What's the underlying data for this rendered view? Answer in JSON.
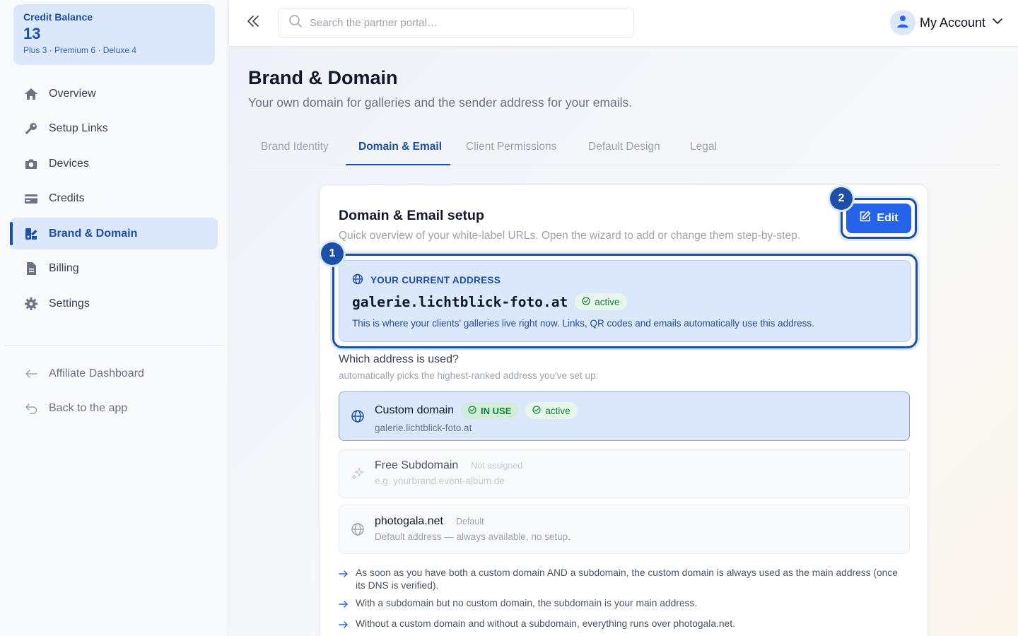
{
  "credit": {
    "title": "Credit Balance",
    "value": "13",
    "sub": "Plus 3 · Premium 6 · Deluxe 4"
  },
  "sidebar": {
    "items": [
      {
        "label": "Overview",
        "icon": "home-icon"
      },
      {
        "label": "Setup Links",
        "icon": "key-icon"
      },
      {
        "label": "Devices",
        "icon": "camera-icon"
      },
      {
        "label": "Credits",
        "icon": "credit-card-icon"
      },
      {
        "label": "Brand & Domain",
        "icon": "brand-icon",
        "active": true
      },
      {
        "label": "Billing",
        "icon": "document-icon"
      },
      {
        "label": "Settings",
        "icon": "gear-icon"
      }
    ],
    "bottom": [
      {
        "label": "Affiliate Dashboard",
        "icon": "arrow-left-icon"
      },
      {
        "label": "Back to the app",
        "icon": "undo-icon"
      }
    ]
  },
  "topbar": {
    "search_placeholder": "Search the partner portal…",
    "account_label": "My Account"
  },
  "page": {
    "title": "Brand & Domain",
    "subtitle": "Your own domain for galleries and the sender address for your emails."
  },
  "tabs": [
    {
      "label": "Brand Identity"
    },
    {
      "label": "Domain & Email",
      "active": true
    },
    {
      "label": "Client Permissions"
    },
    {
      "label": "Default Design"
    },
    {
      "label": "Legal"
    }
  ],
  "card": {
    "title": "Domain & Email setup",
    "subtitle": "Quick overview of your white-label URLs. Open the wizard to add or change them step-by-step.",
    "edit_label": "Edit",
    "step1": "1",
    "step2": "2",
    "current": {
      "label": "YOUR CURRENT ADDRESS",
      "domain": "galerie.lichtblick-foto.at",
      "status": "active",
      "note": "This is where your clients' galleries live right now. Links, QR codes and emails automatically use this address."
    },
    "which": {
      "title": "Which address is used?",
      "subtitle": "automatically picks the highest-ranked address you've set up:"
    },
    "options": [
      {
        "name": "Custom domain",
        "badge": "IN USE",
        "status": "active",
        "desc": "galerie.lichtblick-foto.at"
      },
      {
        "name": "Free Subdomain",
        "tag": "Not assigned",
        "desc": "e.g. yourbrand.event-album.de"
      },
      {
        "name": "photogala.net",
        "tag": "Default",
        "desc": "Default address — always available, no setup."
      }
    ],
    "rules": [
      "As soon as you have both a custom domain AND a subdomain, the custom domain is always used as the main address (once its DNS is verified).",
      "With a subdomain but no custom domain, the subdomain is your main address.",
      "Without a custom domain and without a subdomain, everything runs over photogala.net."
    ]
  },
  "colors": {
    "accent": "#1e4fa8",
    "accent_light": "#dbe7fb",
    "button": "#2563eb",
    "success": "#15803d"
  }
}
